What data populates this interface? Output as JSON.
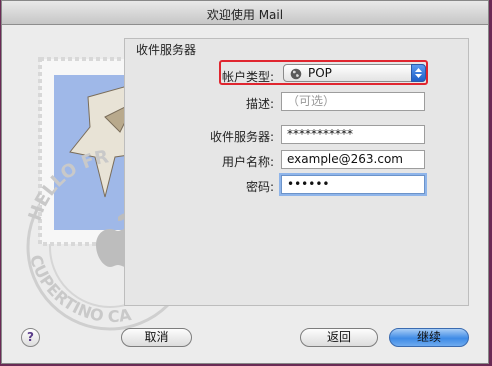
{
  "window": {
    "title": "欢迎使用 Mail"
  },
  "section": {
    "title": "收件服务器"
  },
  "form": {
    "account_type": {
      "label": "帐户类型:",
      "value": "POP"
    },
    "description": {
      "label": "描述:",
      "placeholder": "（可选）"
    },
    "incoming_server": {
      "label": "收件服务器:",
      "value": "***********"
    },
    "username": {
      "label": "用户名称:",
      "value": "example@263.com"
    },
    "password": {
      "label": "密码:",
      "value": "••••••"
    }
  },
  "buttons": {
    "cancel": "取消",
    "back": "返回",
    "continue": "继续",
    "help": "?"
  },
  "watermark": {
    "text_top": "HELLO FR",
    "text_bottom": "CUPERTINO CA"
  },
  "colors": {
    "highlight": "#e0262f",
    "accent": "#3e8be6"
  },
  "icons": {
    "account_type": "globe-icon",
    "popup_arrows": "up-down-arrows-icon",
    "stamp_bird": "eagle-icon",
    "stamp_logo": "apple-icon"
  }
}
